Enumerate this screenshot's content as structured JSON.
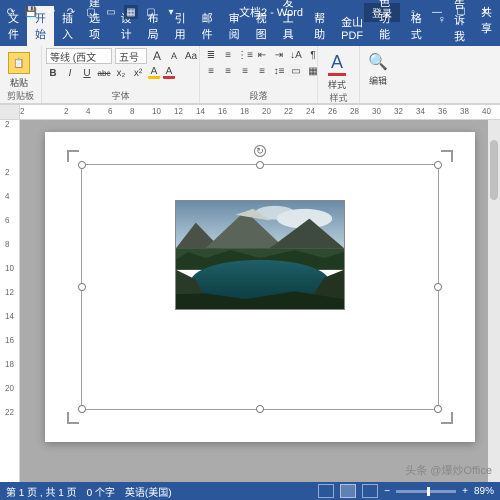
{
  "titlebar": {
    "doc_title": "文档2 - Word",
    "login": "登录"
  },
  "tabs": {
    "file": "文件",
    "home": "开始",
    "insert": "插入",
    "new_option": "新建选项",
    "design": "设计",
    "layout": "布局",
    "references": "引用",
    "mailings": "邮件",
    "review": "审阅",
    "view": "视图",
    "developer": "开发工具",
    "help": "帮助",
    "wps_pdf": "金山PDF",
    "special": "特色功能",
    "format": "格式",
    "tell_me": "告诉我",
    "share": "共享"
  },
  "ribbon": {
    "clipboard": {
      "label": "剪贴板",
      "paste": "粘贴"
    },
    "font": {
      "label": "字体",
      "font_name": "等线 (西文",
      "font_size": "五号",
      "bold": "B",
      "italic": "I",
      "underline": "U",
      "strike": "abc",
      "sub": "x₂",
      "sup": "x²",
      "Aa": "Aa",
      "A_big": "A",
      "A_small": "A"
    },
    "paragraph": {
      "label": "段落"
    },
    "styles": {
      "label": "样式",
      "btn": "样式",
      "letter": "A"
    },
    "editing": {
      "label": "",
      "btn": "编辑"
    }
  },
  "ruler": {
    "h": [
      "2",
      "",
      "2",
      "4",
      "6",
      "8",
      "10",
      "12",
      "14",
      "16",
      "18",
      "20",
      "22",
      "24",
      "26",
      "28",
      "30",
      "32",
      "34",
      "36",
      "38",
      "40"
    ],
    "v": [
      "2",
      "",
      "2",
      "4",
      "6",
      "8",
      "10",
      "12",
      "14",
      "16",
      "18",
      "20",
      "22"
    ]
  },
  "status": {
    "page": "第 1 页 , 共 1 页",
    "words": "0 个字",
    "lang": "英语(美国)",
    "zoom": "89%"
  },
  "watermark": "头条 @爆炒Office"
}
